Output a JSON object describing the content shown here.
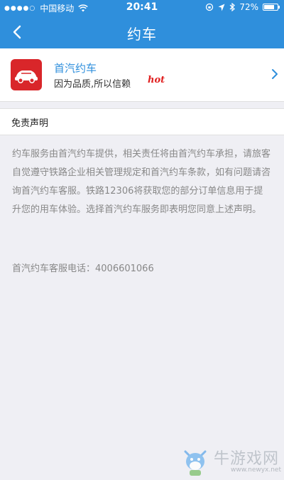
{
  "status_bar": {
    "carrier": "中国移动",
    "time": "20:41",
    "battery": "72%"
  },
  "navbar": {
    "title": "约车"
  },
  "app_entry": {
    "name": "首汽约车",
    "description": "因为品质,所以信赖",
    "badge": "hot"
  },
  "disclaimer": {
    "title": "免责声明",
    "body": "约车服务由首汽约车提供，相关责任将由首汽约车承担，请旅客自觉遵守铁路企业相关管理规定和首汽约车条款，如有问题请咨询首汽约车客服。铁路12306将获取您的部分订单信息用于提升您的用车体验。选择首汽约车服务即表明您同意上述声明。",
    "phone": "首汽约车客服电话：4006601066"
  },
  "watermark": {
    "text": "牛游戏网",
    "url": "www.newyx.net"
  },
  "colors": {
    "primary": "#2f8fdc",
    "background": "#efeff4",
    "hot": "#e02020",
    "logo": "#d9262a"
  }
}
